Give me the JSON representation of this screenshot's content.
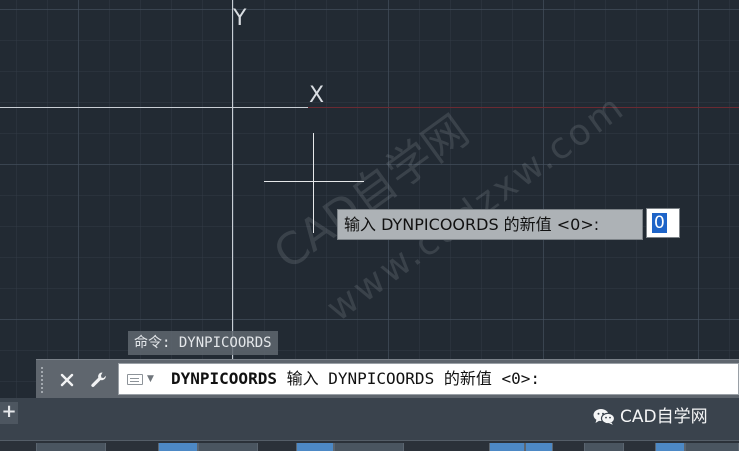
{
  "canvas": {
    "axis_labels": {
      "y": "Y",
      "x": "X"
    },
    "watermark": {
      "main": "CAD自学网",
      "url": "www.cadzxw.com"
    }
  },
  "dynamic_input": {
    "prompt": "输入 DYNPICOORDS 的新值 <0>:",
    "value": "0"
  },
  "command_history": {
    "line": "命令: DYNPICOORDS"
  },
  "command_line": {
    "command_name": "DYNPICOORDS",
    "prompt_text": " 输入 DYNPICOORDS 的新值 <0>:"
  },
  "status_bar": {
    "add_layout_label": "+",
    "brand": "CAD自学网"
  },
  "colors": {
    "canvas_bg": "#222a33",
    "input_highlight": "#1e64c8",
    "dynamic_prompt_bg": "#adb2b6",
    "command_bar_bg": "#5f666e"
  },
  "icons": {
    "close": "close-icon",
    "customize": "wrench-icon",
    "recent_commands": "recent-commands-icon",
    "brand": "wechat-icon"
  }
}
